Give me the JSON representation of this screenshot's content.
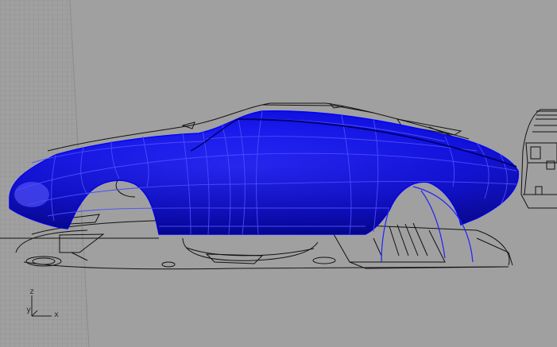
{
  "viewport": {
    "background": "#a0a0a0",
    "surface_color": "#1010f0",
    "wire_color": "#111111",
    "curve_color": "#2222ff",
    "axis_widget": {
      "x": "x",
      "y": "y",
      "z": "z"
    }
  }
}
